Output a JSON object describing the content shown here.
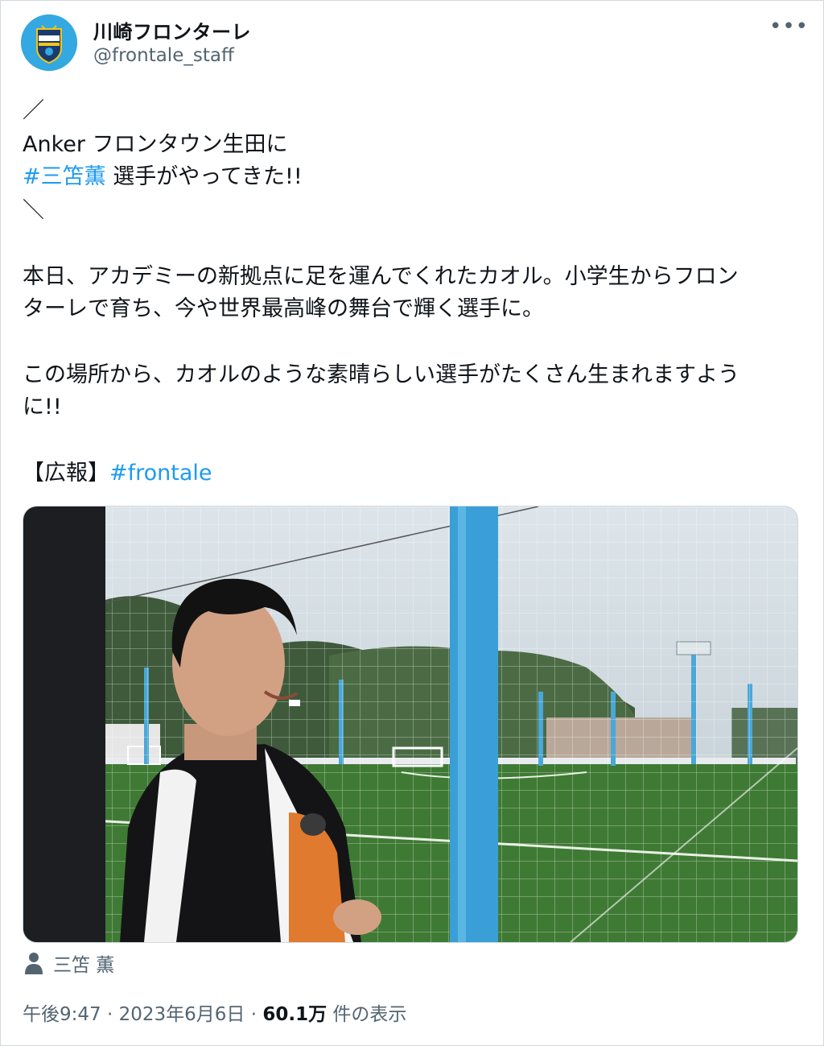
{
  "author": {
    "display_name": "川崎フロンターレ",
    "handle": "@frontale_staff",
    "more_label": "•••"
  },
  "tweet": {
    "lines": {
      "open_slash": "／",
      "heading_1": "Anker フロンタウン生田に",
      "hashtag_player": "#三笘薫",
      "heading_2_rest": " 選手がやってきた!!",
      "close_slash": "＼",
      "para1_line1": "本日、アカデミーの新拠点に足を運んでくれたカオル。小学生からフロン",
      "para1_line2": "ターレで育ち、今や世界最高峰の舞台で輝く選手に。",
      "para2_line1": "この場所から、カオルのような素晴らしい選手がたくさん生まれますよう",
      "para2_line2": "に!!",
      "pr_label": "【広報】",
      "hashtag_club": "#frontale"
    }
  },
  "media": {
    "tagged_person": "三笘 薫",
    "tag_icon": "person-icon"
  },
  "meta": {
    "time": "午後9:47",
    "date": "2023年6月6日",
    "views_value": "60.1万",
    "views_label": " 件の表示",
    "separator": " · "
  },
  "colors": {
    "link": "#1d9bf0",
    "secondary_text": "#536471",
    "club_blue": "#34a8e0"
  }
}
